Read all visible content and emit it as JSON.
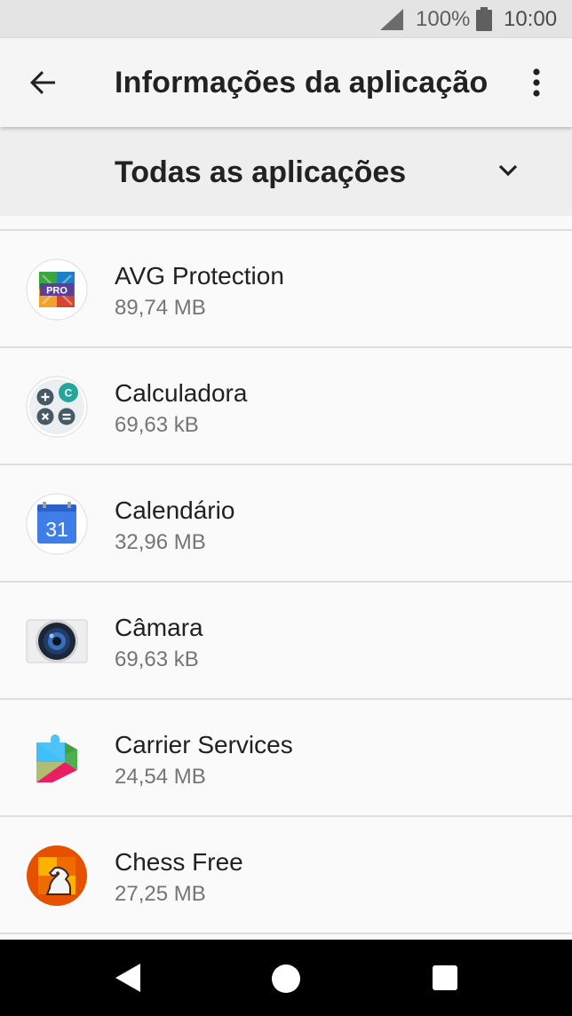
{
  "status_bar": {
    "battery_percent": "100%",
    "time": "10:00"
  },
  "app_bar": {
    "title": "Informações da aplicação"
  },
  "filter": {
    "label": "Todas as aplicações"
  },
  "apps": [
    {
      "name": "AVG Protection",
      "size": "89,74 MB",
      "icon": "avg-protection-icon",
      "icon_text": "PRO"
    },
    {
      "name": "Calculadora",
      "size": "69,63 kB",
      "icon": "calculator-icon"
    },
    {
      "name": "Calendário",
      "size": "32,96 MB",
      "icon": "calendar-icon",
      "icon_text": "31"
    },
    {
      "name": "Câmara",
      "size": "69,63 kB",
      "icon": "camera-icon"
    },
    {
      "name": "Carrier Services",
      "size": "24,54 MB",
      "icon": "carrier-services-icon"
    },
    {
      "name": "Chess Free",
      "size": "27,25 MB",
      "icon": "chess-free-icon"
    }
  ],
  "colors": {
    "status_bar_bg": "#e4e4e4",
    "app_bar_bg": "#f5f5f5",
    "filter_bg": "#eeeeee",
    "divider": "#dedede",
    "nav_bg": "#000000"
  }
}
